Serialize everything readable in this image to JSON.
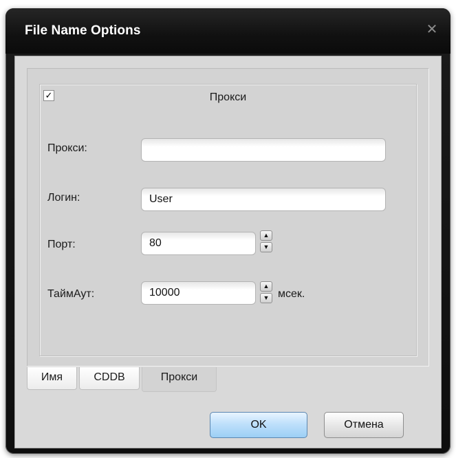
{
  "window": {
    "title": "File Name Options",
    "close_glyph": "✕"
  },
  "proxy_group": {
    "enabled": true,
    "checkbox_glyph": "✓",
    "title": "Прокси"
  },
  "fields": {
    "proxy": {
      "label": "Прокси:",
      "value": ""
    },
    "login": {
      "label": "Логин:",
      "value": "User"
    },
    "port": {
      "label": "Порт:",
      "value": "80"
    },
    "timeout": {
      "label": "ТаймАут:",
      "value": "10000",
      "unit": "мсек."
    }
  },
  "spinner": {
    "up_glyph": "▲",
    "down_glyph": "▼"
  },
  "tabs": [
    {
      "label": "Имя",
      "active": false
    },
    {
      "label": "CDDB",
      "active": false
    },
    {
      "label": "Прокси",
      "active": true
    }
  ],
  "buttons": {
    "ok_label": "OK",
    "cancel_label": "Отмена"
  },
  "colors": {
    "title_bar": "#111111",
    "client_bg": "#d9d9d9",
    "ok_accent": "#9ccff5"
  },
  "icons": {
    "close": "close-icon",
    "spin_up": "arrow-up-icon",
    "spin_down": "arrow-down-icon",
    "check": "check-icon"
  }
}
